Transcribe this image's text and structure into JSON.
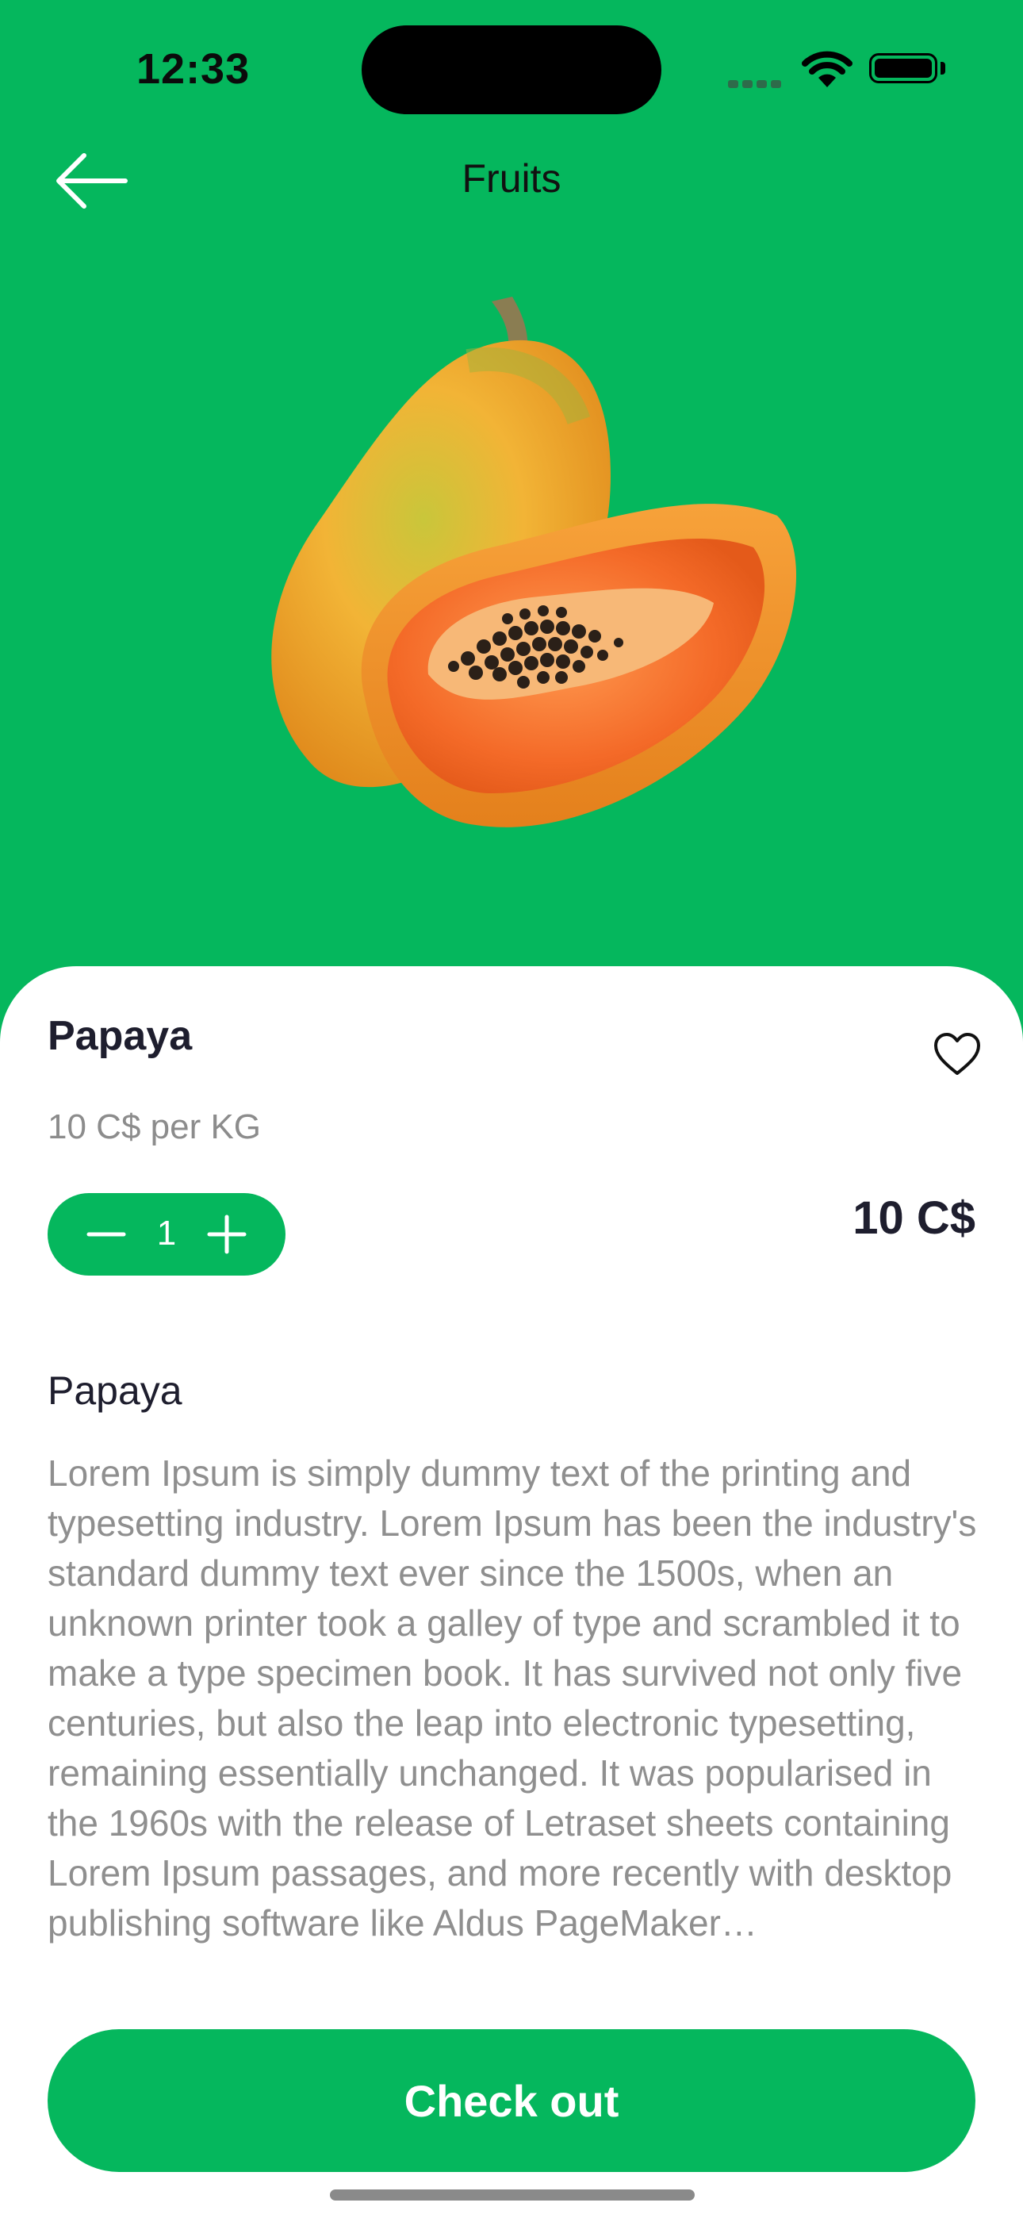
{
  "status_bar": {
    "time": "12:33"
  },
  "header": {
    "title": "Fruits",
    "back_icon": "arrow-left-icon"
  },
  "product": {
    "name": "Papaya",
    "unit_price": "10 C$ per KG",
    "quantity": "1",
    "total": "10 C$",
    "favorite_icon": "heart-outline-icon",
    "description_title": "Papaya",
    "description": "Lorem Ipsum is simply dummy text of the printing and typesetting industry. Lorem Ipsum has been the industry's standard dummy text ever since the 1500s, when an unknown printer took a galley of type and scrambled it to make a type specimen book. It has survived not only five centuries, but also the leap into electronic typesetting, remaining essentially unchanged. It was popularised in the 1960s with the release of Letraset sheets containing Lorem Ipsum passages, and more recently with desktop publishing software like Aldus PageMaker…"
  },
  "actions": {
    "checkout_label": "Check out"
  },
  "colors": {
    "accent": "#05B75D",
    "text_dark": "#1e1e2e",
    "text_muted": "#8f8f8f"
  }
}
